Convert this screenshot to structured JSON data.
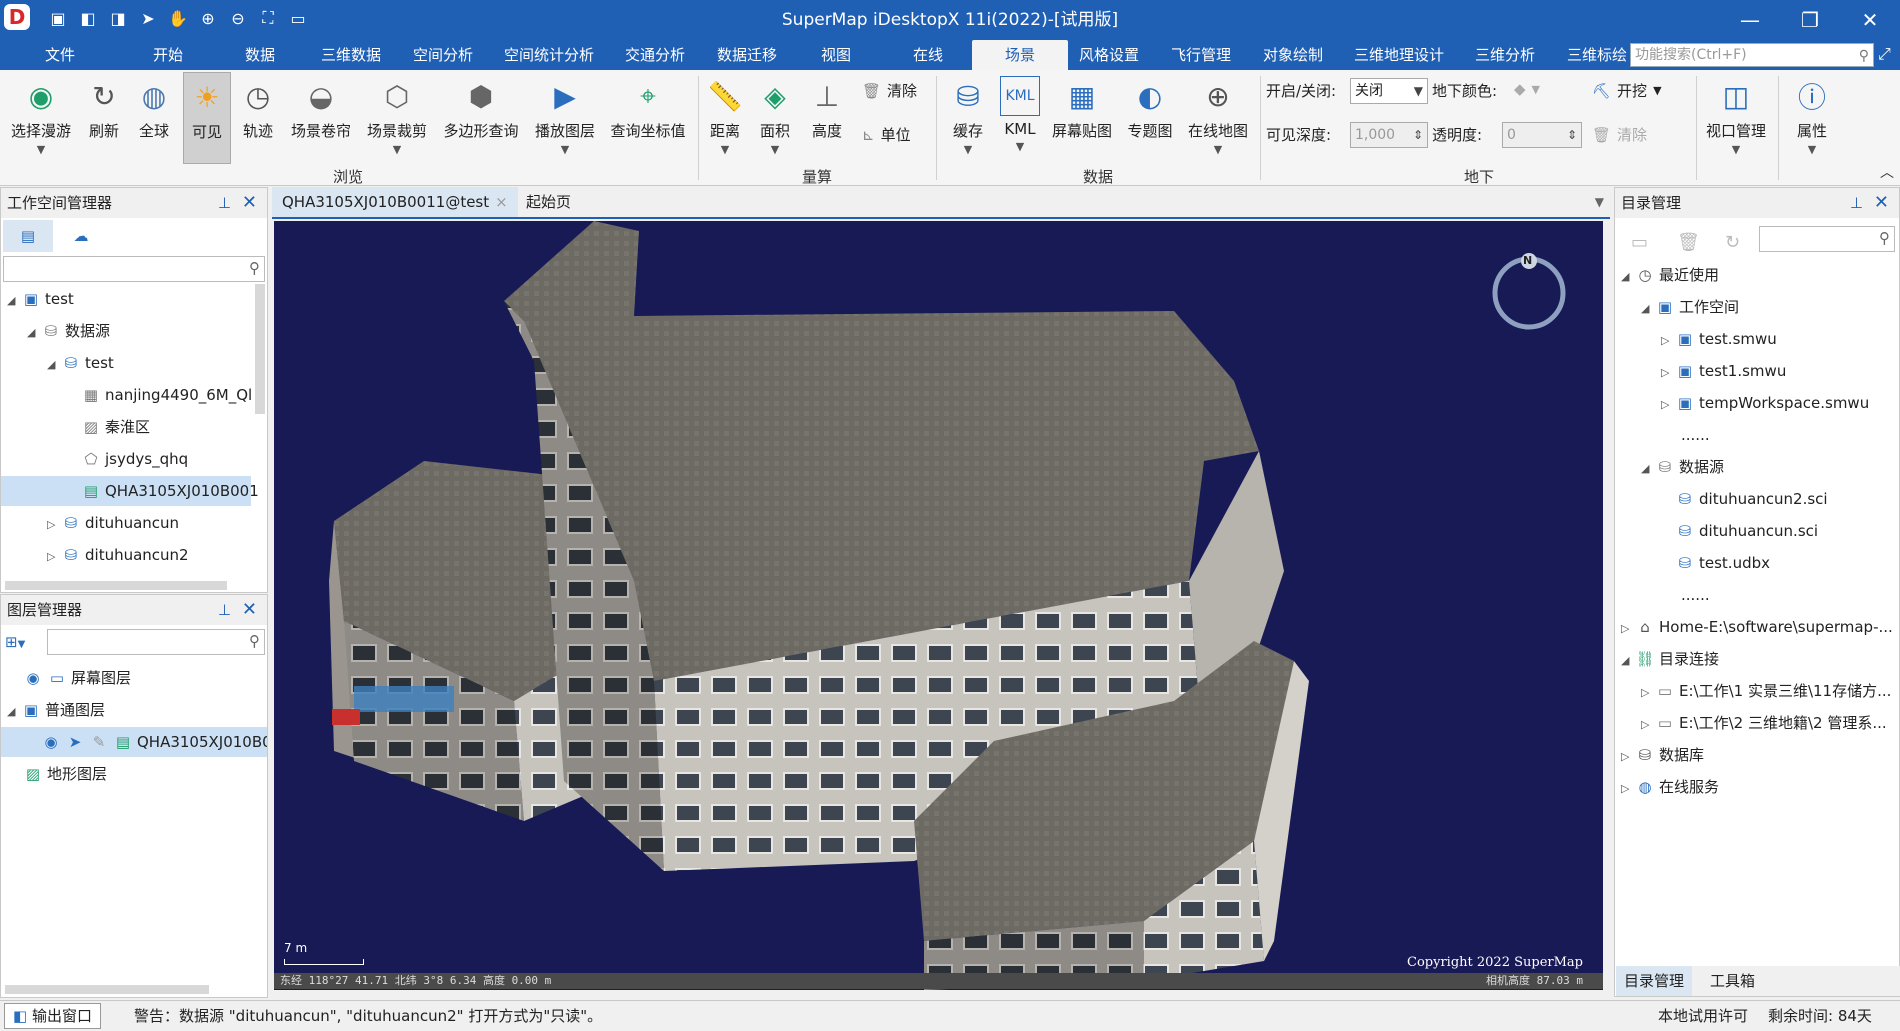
{
  "app": {
    "title": "SuperMap iDesktopX 11i(2022)-[试用版]",
    "logo": "D"
  },
  "menu": {
    "tabs": [
      {
        "label": "文件"
      },
      {
        "label": "开始"
      },
      {
        "label": "数据"
      },
      {
        "label": "三维数据"
      },
      {
        "label": "空间分析"
      },
      {
        "label": "空间统计分析"
      },
      {
        "label": "交通分析"
      },
      {
        "label": "数据迁移"
      },
      {
        "label": "视图"
      },
      {
        "label": "在线"
      },
      {
        "label": "场景"
      },
      {
        "label": "风格设置"
      },
      {
        "label": "飞行管理"
      },
      {
        "label": "对象绘制"
      },
      {
        "label": "三维地理设计"
      },
      {
        "label": "三维分析"
      },
      {
        "label": "三维标绘"
      }
    ],
    "active": "场景",
    "search_placeholder": "功能搜索(Ctrl+F)"
  },
  "ribbon": {
    "browse": {
      "label": "浏览",
      "buttons": [
        {
          "label": "选择漫游"
        },
        {
          "label": "刷新"
        },
        {
          "label": "全球"
        },
        {
          "label": "可见"
        },
        {
          "label": "轨迹"
        },
        {
          "label": "场景卷帘"
        },
        {
          "label": "场景裁剪"
        },
        {
          "label": "多边形查询"
        },
        {
          "label": "播放图层"
        },
        {
          "label": "查询坐标值"
        }
      ]
    },
    "measure": {
      "label": "量算",
      "buttons": [
        {
          "label": "距离"
        },
        {
          "label": "面积"
        },
        {
          "label": "高度"
        }
      ],
      "clear": "清除",
      "unit": "单位"
    },
    "data": {
      "label": "数据",
      "buttons": [
        {
          "label": "缓存"
        },
        {
          "label": "KML"
        },
        {
          "label": "屏幕贴图"
        },
        {
          "label": "专题图"
        },
        {
          "label": "在线地图"
        }
      ]
    },
    "underground": {
      "label": "地下",
      "toggle_label": "开启/关闭:",
      "toggle_value": "关闭",
      "color_label": "地下颜色:",
      "excavate": "开挖",
      "depth_label": "可见深度:",
      "depth_value": "1,000",
      "alpha_label": "透明度:",
      "alpha_value": "0",
      "clear": "清除"
    },
    "view": {
      "viewport": "视口管理",
      "props": "属性"
    }
  },
  "workspace_panel": {
    "title": "工作空间管理器",
    "tree": [
      {
        "label": "test"
      },
      {
        "label": "数据源"
      },
      {
        "label": "test"
      },
      {
        "label": "nanjing4490_6M_Ql"
      },
      {
        "label": "秦淮区"
      },
      {
        "label": "jsydys_qhq"
      },
      {
        "label": "QHA3105XJ010B001"
      },
      {
        "label": "dituhuancun"
      },
      {
        "label": "dituhuancun2"
      }
    ]
  },
  "layer_panel": {
    "title": "图层管理器",
    "tree": [
      {
        "label": "屏幕图层"
      },
      {
        "label": "普通图层"
      },
      {
        "label": "QHA3105XJ010B0("
      },
      {
        "label": "地形图层"
      }
    ]
  },
  "doc_tabs": [
    {
      "label": "QHA3105XJ010B0011@test"
    },
    {
      "label": "起始页"
    }
  ],
  "scene": {
    "compass": "N",
    "scale": "7 m",
    "copyright": "Copyright 2022 SuperMap",
    "coords": "东经 118°27   41.71   北纬 3°8   6.34   高度 0.00 m",
    "camera": "相机高度 87.03 m"
  },
  "catalog_panel": {
    "title": "目录管理",
    "tree": [
      {
        "label": "最近使用"
      },
      {
        "label": "工作空间"
      },
      {
        "label": "test.smwu"
      },
      {
        "label": "test1.smwu"
      },
      {
        "label": "tempWorkspace.smwu"
      },
      {
        "label": "......"
      },
      {
        "label": "数据源"
      },
      {
        "label": "dituhuancun2.sci"
      },
      {
        "label": "dituhuancun.sci"
      },
      {
        "label": "test.udbx"
      },
      {
        "label": "......"
      },
      {
        "label": "Home-E:\\software\\supermap-..."
      },
      {
        "label": "目录连接"
      },
      {
        "label": "E:\\工作\\1 实景三维\\11存储方..."
      },
      {
        "label": "E:\\工作\\2 三维地籍\\2 管理系..."
      },
      {
        "label": "数据库"
      },
      {
        "label": "在线服务"
      }
    ],
    "bottom_tabs": [
      {
        "label": "目录管理"
      },
      {
        "label": "工具箱"
      }
    ]
  },
  "status": {
    "output": "输出窗口",
    "warning": "警告：数据源 \"dituhuancun\", \"dituhuancun2\" 打开方式为\"只读\"。",
    "license": "本地试用许可",
    "remaining": "剩余时间: 84天"
  },
  "colors": {
    "accent": "#1f5fb4",
    "scene_bg": "#181a55"
  }
}
